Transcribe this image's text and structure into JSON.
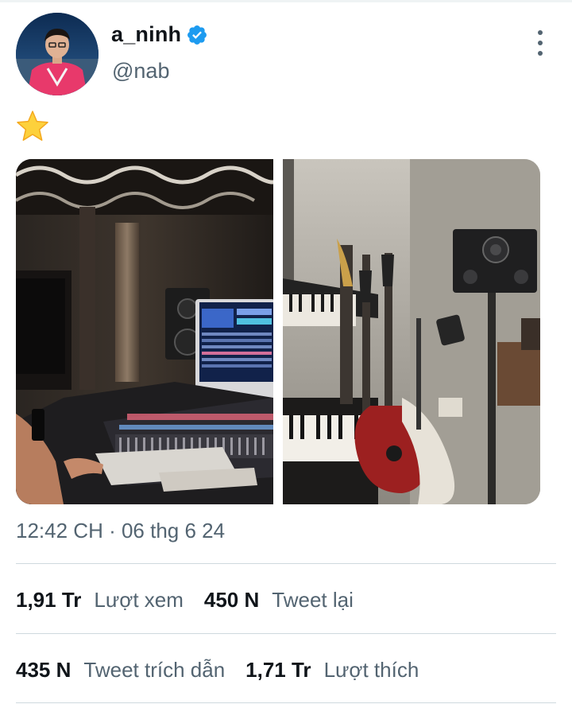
{
  "author": {
    "display_name": "a_ninh",
    "handle": "@nab",
    "verified": true
  },
  "tweet": {
    "text": "⭐",
    "media": [
      {
        "kind": "photo",
        "subject": "studio-mixing-console"
      },
      {
        "kind": "photo",
        "subject": "studio-guitars-keyboards"
      }
    ],
    "timestamp": "12:42 CH · 06 thg 6 24"
  },
  "stats": {
    "views": {
      "value": "1,91 Tr",
      "label": "Lượt xem"
    },
    "retweets": {
      "value": "450 N",
      "label": "Tweet lại"
    },
    "quotes": {
      "value": "435 N",
      "label": "Tweet trích dẫn"
    },
    "likes": {
      "value": "1,71 Tr",
      "label": "Lượt thích"
    }
  },
  "colors": {
    "primary_text": "#0f1419",
    "secondary_text": "#536471",
    "verified_blue": "#1d9bf0",
    "divider": "#cfd9de"
  }
}
